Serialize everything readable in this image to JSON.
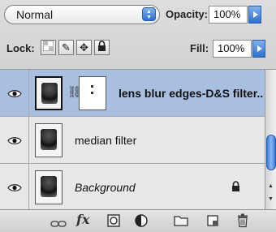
{
  "blend_mode": {
    "value": "Normal"
  },
  "opacity": {
    "label": "Opacity:",
    "value": "100%"
  },
  "lock": {
    "label": "Lock:"
  },
  "fill": {
    "label": "Fill:",
    "value": "100%"
  },
  "layers": [
    {
      "name": "lens blur edges-D&S filter..",
      "selected": true,
      "has_mask": true,
      "visible": true
    },
    {
      "name": "median filter",
      "selected": false,
      "has_mask": false,
      "visible": true
    },
    {
      "name": "Background",
      "selected": false,
      "has_mask": false,
      "visible": true,
      "locked": true
    }
  ],
  "bottom_toolbar": {
    "fx_label": "fx"
  },
  "colors": {
    "selection": "#a9bfe0",
    "accent": "#2e6fd0"
  }
}
